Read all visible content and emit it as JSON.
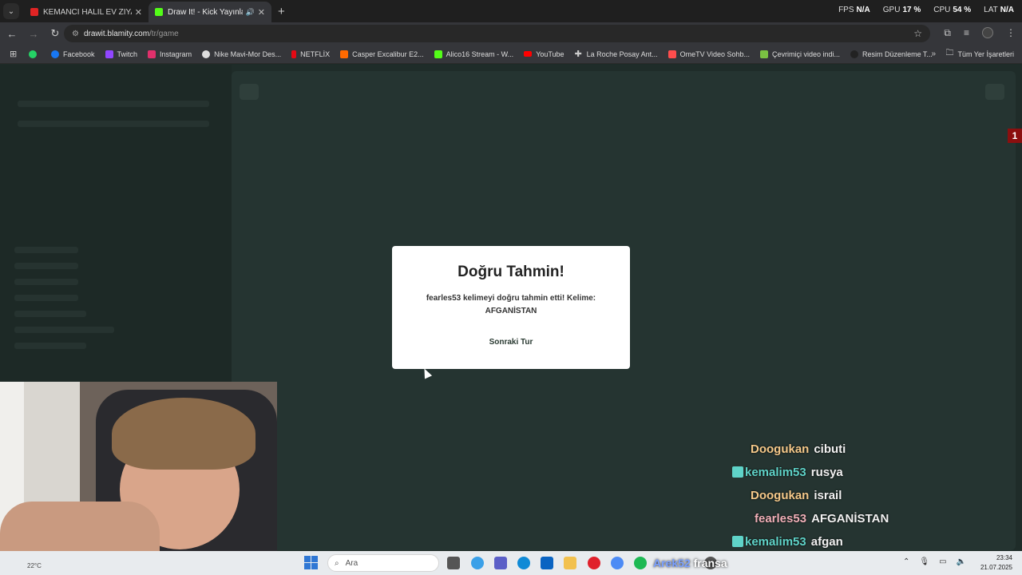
{
  "tabs": [
    {
      "title": "KEMANCI HALİL EV ZİYARETİ VE",
      "favicon_color": "#e02424",
      "active": false
    },
    {
      "title": "Draw It! - Kick Yayınları İçin",
      "favicon_color": "#53fc18",
      "active": true
    }
  ],
  "perf": {
    "fps_label": "FPS",
    "fps_value": "N/A",
    "gpu_label": "GPU",
    "gpu_value": "17 %",
    "cpu_label": "CPU",
    "cpu_value": "54 %",
    "lat_label": "LAT",
    "lat_value": "N/A"
  },
  "address": {
    "domain": "drawit.blamity.com",
    "path": "/tr/game"
  },
  "bookmarks": [
    {
      "label": "",
      "color": "#25d366",
      "icon": "whatsapp-icon"
    },
    {
      "label": "Facebook",
      "color": "#1877f2",
      "icon": "facebook-icon"
    },
    {
      "label": "Twitch",
      "color": "#9146ff",
      "icon": "twitch-icon"
    },
    {
      "label": "Instagram",
      "color": "#e1306c",
      "icon": "instagram-icon"
    },
    {
      "label": "Nike Mavi-Mor Des...",
      "color": "#dddddd",
      "icon": "globe-icon"
    },
    {
      "label": "NETFLİX",
      "color": "#e50914",
      "icon": "netflix-icon"
    },
    {
      "label": "Casper Excalibur E2...",
      "color": "#ff6a00",
      "icon": "casper-icon"
    },
    {
      "label": "Alico16 Stream - W...",
      "color": "#53fc18",
      "icon": "kick-icon"
    },
    {
      "label": "YouTube",
      "color": "#ff0000",
      "icon": "youtube-icon"
    },
    {
      "label": "La Roche Posay Ant...",
      "color": "#cccccc",
      "icon": "plus-icon"
    },
    {
      "label": "OmeTV Video Sohb...",
      "color": "#ff4d4d",
      "icon": "ometv-icon"
    },
    {
      "label": "Çevrimiçi video indi...",
      "color": "#7ac142",
      "icon": "download-icon"
    },
    {
      "label": "Resim Düzenleme T...",
      "color": "#333333",
      "icon": "image-icon"
    }
  ],
  "bookmarks_all": "Tüm Yer İşaretleri",
  "modal": {
    "title": "Doğru Tahmin!",
    "message": "fearles53 kelimeyi doğru tahmin etti! Kelime: AFGANİSTAN",
    "button": "Sonraki Tur"
  },
  "side_badge": "1",
  "chat": [
    {
      "user": "Doogukan",
      "message": "cibuti",
      "color": "#f5c98a",
      "badge": false
    },
    {
      "user": "kemalim53",
      "message": "rusya",
      "color": "#5fd3c8",
      "badge": true
    },
    {
      "user": "Doogukan",
      "message": "israil",
      "color": "#f5c98a",
      "badge": false
    },
    {
      "user": "fearles53",
      "message": "AFGANİSTAN",
      "color": "#f0b0b8",
      "badge": false
    },
    {
      "user": "kemalim53",
      "message": "afgan",
      "color": "#5fd3c8",
      "badge": true
    }
  ],
  "taskbar": {
    "weather": "22°C",
    "search_placeholder": "Ara",
    "time": "23:34",
    "date": "21.07.2025"
  },
  "overlay": {
    "prefix": "Arek52",
    "word": "fransa"
  }
}
